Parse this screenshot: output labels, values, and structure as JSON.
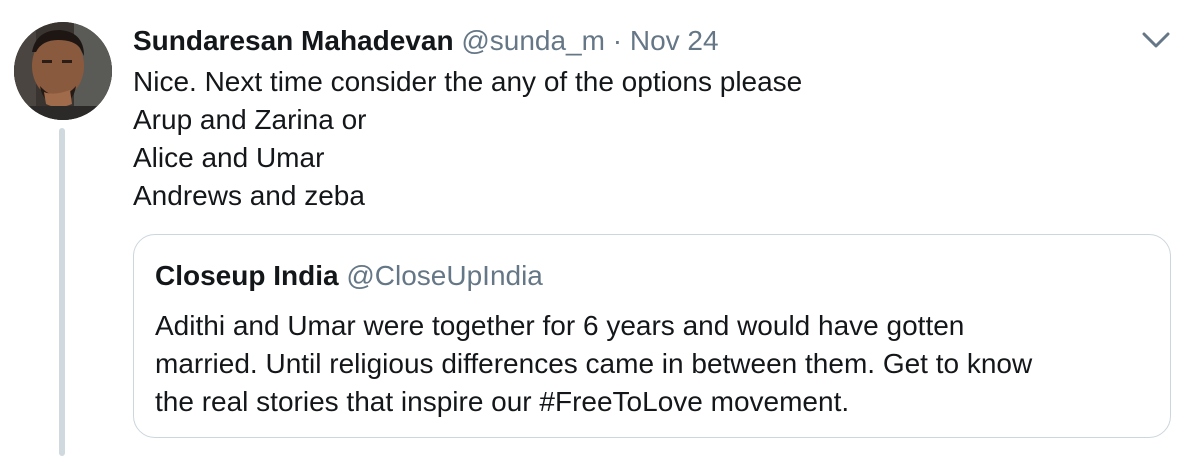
{
  "tweet": {
    "author_name": "Sundaresan Mahadevan",
    "author_handle": "@sunda_m",
    "separator": "·",
    "date": "Nov 24",
    "lines": [
      "Nice. Next time consider the any of the options please",
      "Arup and Zarina or",
      "Alice and Umar",
      "Andrews and zeba"
    ]
  },
  "quoted_tweet": {
    "author_name": "Closeup India",
    "author_handle": "@CloseUpIndia",
    "lines": [
      "Adithi and Umar were together for 6 years and would have gotten",
      "married. Until religious differences came in between them. Get to know",
      "the real stories that inspire our #FreeToLove movement."
    ]
  },
  "icons": {
    "menu": "chevron-down-icon",
    "avatar": "user-avatar"
  },
  "colors": {
    "text_primary": "#14171a",
    "text_secondary": "#657786",
    "border": "#ccd6dd",
    "thread_line": "#cfd9de"
  }
}
